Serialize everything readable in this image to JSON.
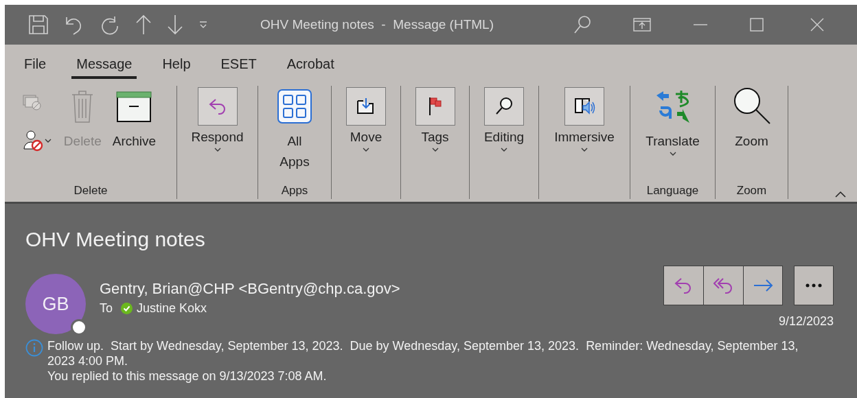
{
  "window": {
    "title": "OHV Meeting notes  -  Message (HTML)"
  },
  "tabs": [
    {
      "label": "File",
      "selected": false
    },
    {
      "label": "Message",
      "selected": true
    },
    {
      "label": "Help",
      "selected": false
    },
    {
      "label": "ESET",
      "selected": false
    },
    {
      "label": "Acrobat",
      "selected": false
    }
  ],
  "ribbon_groups": [
    {
      "label": "Delete",
      "buttons": [
        {
          "label": "Delete",
          "disabled": true,
          "dropdown": false
        },
        {
          "label": "Archive",
          "disabled": false,
          "dropdown": false
        }
      ]
    },
    {
      "buttons": [
        {
          "label": "Respond",
          "disabled": false,
          "dropdown": true
        }
      ]
    },
    {
      "label": "Apps",
      "buttons": [
        {
          "label": "All Apps",
          "disabled": false,
          "dropdown": false
        }
      ]
    },
    {
      "buttons": [
        {
          "label": "Move",
          "disabled": false,
          "dropdown": true
        }
      ]
    },
    {
      "buttons": [
        {
          "label": "Tags",
          "disabled": false,
          "dropdown": true
        }
      ]
    },
    {
      "buttons": [
        {
          "label": "Editing",
          "disabled": false,
          "dropdown": true
        }
      ]
    },
    {
      "buttons": [
        {
          "label": "Immersive",
          "disabled": false,
          "dropdown": true
        }
      ]
    },
    {
      "label": "Language",
      "buttons": [
        {
          "label": "Translate",
          "disabled": false,
          "dropdown": true
        }
      ]
    },
    {
      "label": "Zoom",
      "buttons": [
        {
          "label": "Zoom",
          "disabled": false,
          "dropdown": false
        }
      ]
    }
  ],
  "message": {
    "subject": "OHV Meeting notes",
    "avatar_initials": "GB",
    "sender": "Gentry, Brian@CHP <BGentry@chp.ca.gov>",
    "to_label": "To",
    "recipient": "Justine Kokx",
    "date": "9/12/2023",
    "info": [
      "Follow up.  Start by Wednesday, September 13, 2023.  Due by Wednesday, September 13, 2023.  Reminder: Wednesday, September 13, 2023 4:00 PM.",
      "You replied to this message on 9/13/2023 7:08 AM."
    ]
  }
}
